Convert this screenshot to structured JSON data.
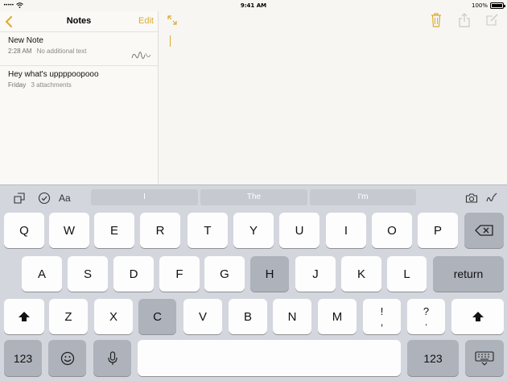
{
  "status_bar": {
    "signal": "•••••",
    "time": "9:41 AM",
    "battery": "100%"
  },
  "sidebar": {
    "title": "Notes",
    "edit_label": "Edit",
    "notes": [
      {
        "title": "New Note",
        "date": "2:28 AM",
        "preview": "No additional text"
      },
      {
        "title": "Hey what's uppppoopooo",
        "date": "Friday",
        "preview": "3 attachments"
      }
    ]
  },
  "keyboard": {
    "shortcuts": {
      "format_label": "Aa"
    },
    "suggestions": [
      "I",
      "The",
      "I'm"
    ],
    "rows": {
      "row1": [
        "Q",
        "W",
        "E",
        "R",
        "T",
        "Y",
        "U",
        "I",
        "O",
        "P"
      ],
      "row2": [
        "A",
        "S",
        "D",
        "F",
        "G",
        "H",
        "J",
        "K",
        "L"
      ],
      "row3": [
        "Z",
        "X",
        "C",
        "V",
        "B",
        "N",
        "M"
      ],
      "punct1_top": "!",
      "punct1_bottom": ",",
      "punct2_top": "?",
      "punct2_bottom": "."
    },
    "return_label": "return",
    "numbers_label": "123",
    "highlighted_keys": [
      "H",
      "C"
    ]
  },
  "colors": {
    "accent": "#dcab2d",
    "keyboard_bg": "#d3d6dd",
    "key_bg": "#fdfdfe",
    "key_dark_bg": "#adb2bb"
  },
  "icons": {
    "back": "chevron-left-icon",
    "expand": "expand-icon",
    "trash": "trash-icon",
    "share": "share-icon",
    "compose": "compose-icon",
    "delete": "delete-key-icon",
    "shift": "shift-icon",
    "emoji": "emoji-icon",
    "dictation": "microphone-icon",
    "hide_keyboard": "keyboard-dismiss-icon"
  }
}
